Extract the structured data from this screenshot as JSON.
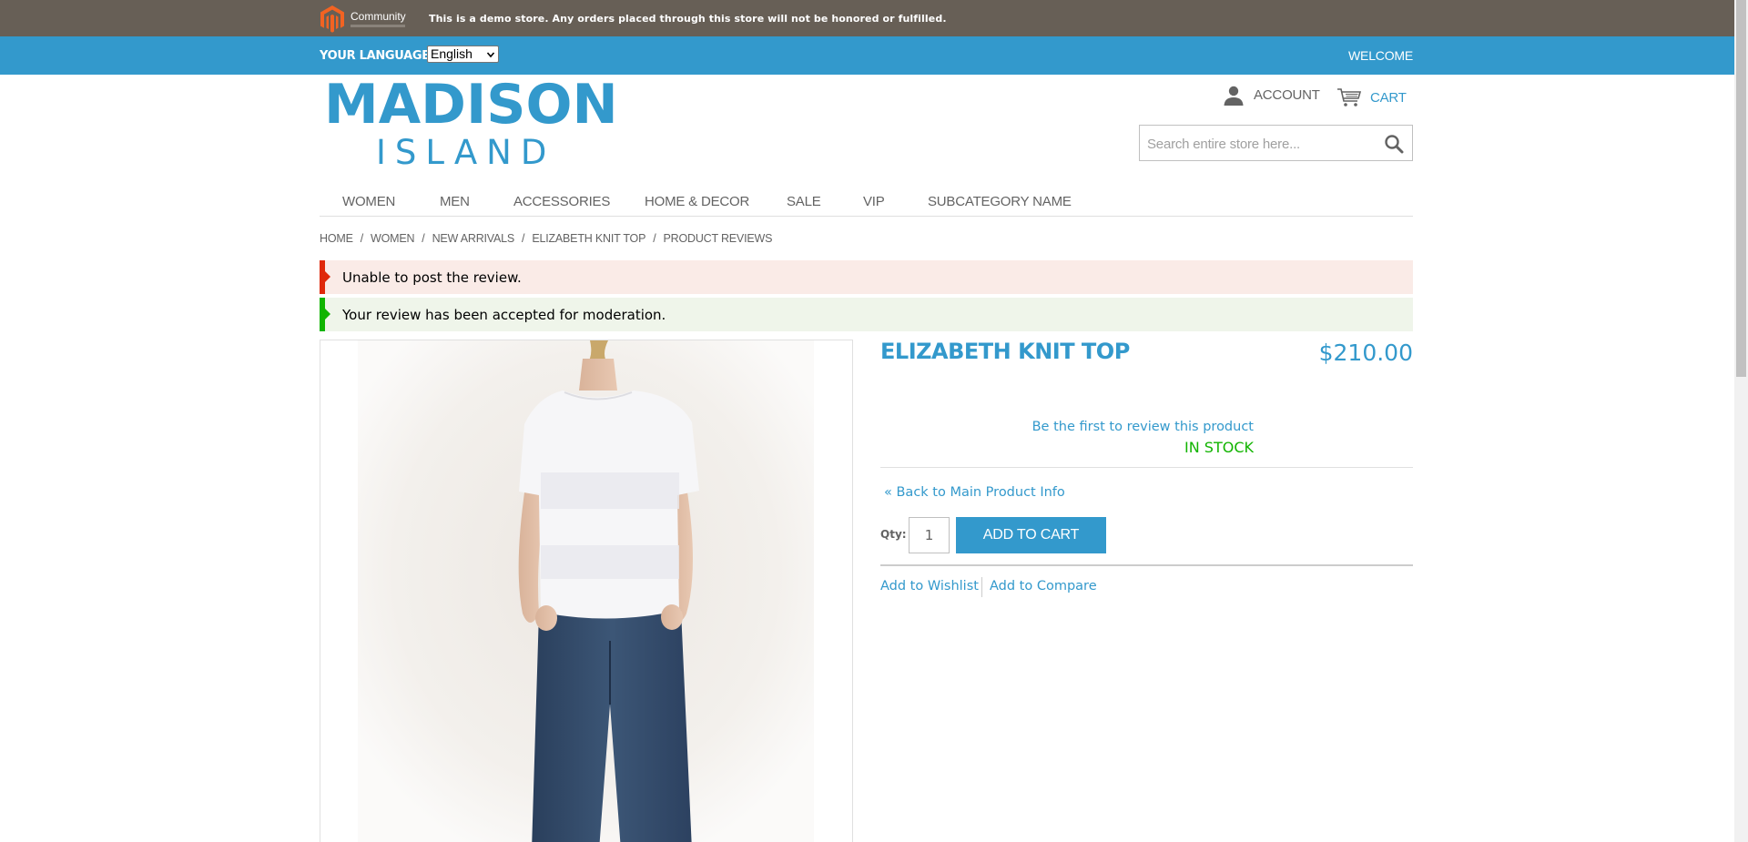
{
  "demo_notice": {
    "logo_text": "Community",
    "text": "This is a demo store. Any orders placed through this store will not be honored or fulfilled."
  },
  "language_bar": {
    "label": "YOUR LANGUAGE:",
    "selected": "English",
    "welcome": "WELCOME"
  },
  "logo": {
    "line1": "MADISON",
    "line2": "ISLAND"
  },
  "header": {
    "account_label": "ACCOUNT",
    "cart_label": "CART",
    "search_placeholder": "Search entire store here..."
  },
  "nav": {
    "items": [
      "WOMEN",
      "MEN",
      "ACCESSORIES",
      "HOME & DECOR",
      "SALE",
      "VIP",
      "SUBCATEGORY NAME"
    ]
  },
  "breadcrumb": {
    "items": [
      "HOME",
      "WOMEN",
      "NEW ARRIVALS",
      "ELIZABETH KNIT TOP",
      "PRODUCT REVIEWS"
    ],
    "separator": "/"
  },
  "messages": {
    "error": "Unable to post the review.",
    "success": "Your review has been accepted for moderation."
  },
  "product": {
    "name": "ELIZABETH KNIT TOP",
    "price": "$210.00",
    "review_link": "Be the first to review this product",
    "stock": "IN STOCK",
    "back_link": "« Back to Main Product Info",
    "qty_label": "Qty:",
    "qty_value": "1",
    "add_to_cart": "ADD TO CART",
    "wishlist": "Add to Wishlist",
    "compare": "Add to Compare"
  },
  "colors": {
    "demo_bar": "#675f56",
    "accent": "#3399cc",
    "error": "#df280a",
    "success": "#11b400"
  },
  "icons": [
    "magento-logo-icon",
    "chevron-down-icon",
    "user-icon",
    "cart-icon",
    "search-icon"
  ]
}
